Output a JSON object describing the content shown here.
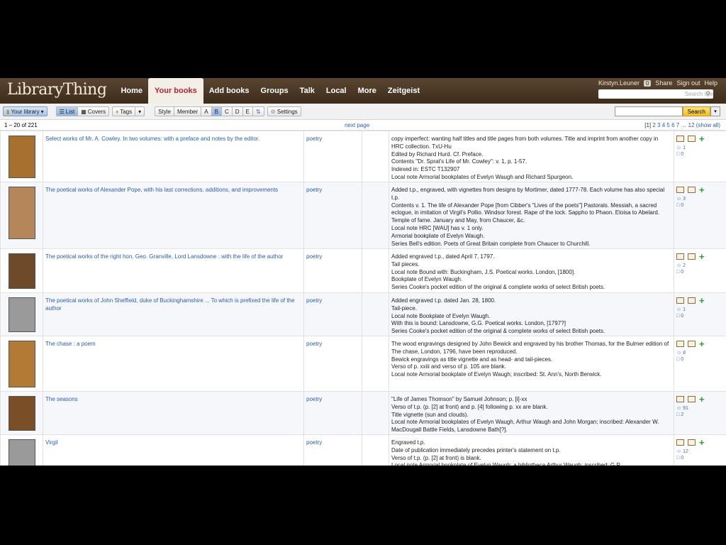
{
  "header": {
    "logo": "LibraryThing",
    "nav": [
      "Home",
      "Your books",
      "Add books",
      "Groups",
      "Talk",
      "Local",
      "More",
      "Zeitgeist"
    ],
    "active_nav": "Your books",
    "user": "Kirstyn.Leuner",
    "badge": "0",
    "links": [
      "Share",
      "Sign out",
      "Help"
    ],
    "search_placeholder": "Search site"
  },
  "toolbar": {
    "your_library": "Your library",
    "list": "List",
    "covers": "Covers",
    "tags": "Tags",
    "style": "Style",
    "member": "Member",
    "letters": [
      "A",
      "B",
      "C",
      "D",
      "E"
    ],
    "selected_letter": "B",
    "settings": "Settings",
    "search_button": "Search"
  },
  "pager": {
    "range": "1 – 20 of 221",
    "next": "next page",
    "current": "[1]",
    "pages": "2 3 4 5 6 7 … 12 (show all)"
  },
  "books": [
    {
      "title": "Select works of Mr. A. Cowley. In two volumes: with a preface and notes by the editor.",
      "tag": "poetry",
      "comments": "copy imperfect: wanting half titles and title pages from both volumes. Title and imprint from another copy in HRC collection. TxU-Hu\nEdited by Richard Hurd. Cf. Preface.\nContents \"Dr. Sprat's Life of Mr. Cowley\": v. 1, p. 1-57.\nIndexed in: ESTC T132907\nLocal note Armorial bookplates of Evelyn Waugh and Richard Spurgeon.",
      "members": "1",
      "reviews": "0",
      "cover_color": "#a8702e"
    },
    {
      "title": "The poetical works of Alexander Pope, with his last corrections, additions, and improvements",
      "tag": "poetry",
      "comments": "Added t.p., engraved, with vignettes from designs by Mortimer, dated 1777-78. Each volume has also special t.p.\nContents v. 1. The life of Alexander Pope [from Cibber's \"Lives of the poets\"] Pastorals. Messiah, a sacred eclogue, in imitation of Virgil's Pollio. Windsor forest. Rape of the lock. Sappho to Phaon. Eloisa to Abelard. Temple of fame. January and May, from Chaucer, &c.\nLocal note HRC [WAU] has v. 1 only.\nArmorial bookplate of Evelyn Waugh.\nSeries Bell's edition. Poets of Great Britain complete from Chaucer to Churchill.",
      "members": "3",
      "reviews": "0",
      "cover_color": "#b5865a"
    },
    {
      "title": "The poetical works of the right hon. Geo. Granville, Lord Lansdowne : with the life of the author",
      "tag": "poetry",
      "comments": "Added engraved t.p., dated April 7, 1797.\nTail pieces.\nLocal note Bound with: Buckingham, J.S. Poetical works. London, [1800].\nBookplate of Evelyn Waugh.\nSeries Cooke's pocket edition of the original & complete works of select British poets.",
      "members": "2",
      "reviews": "0",
      "cover_color": "#6e4a2a"
    },
    {
      "title": "The poetical works of John Sheffield, duke of Buckinghamshire ... To which is prefixed the life of the author",
      "tag": "poetry",
      "comments": "Added engraved t.p. dated Jan. 28, 1800.\nTail-piece.\nLocal note Bookplate of Evelyn Waugh.\nWith this is bound: Lansdowne, G.G. Poetical works. London, [1797?]\nSeries Cooke's pocket edition of the original & complete works of select British poets.",
      "members": "1",
      "reviews": "0",
      "cover_color": "#9a9a9a"
    },
    {
      "title": "The chase : a poem",
      "tag": "poetry",
      "comments": "The wood engravings designed by John Bewick and engraved by his brother Thomas, for the Bulmer edition of The chase, London, 1796, have been reproduced.\nBewick engravings as title vignette and as head- and tail-pieces.\nVerso of p. xxiii and verso of p. 105 are blank.\nLocal note Armorial bookplate of Evelyn Waugh; inscribed: St. Ann's, North Berwick.",
      "members": "8",
      "reviews": "0",
      "cover_color": "#b37a35"
    },
    {
      "title": "The seasons",
      "tag": "poetry",
      "comments": "\"Life of James Thomson\" by Samuel Johnson; p. [i]-xx\nVerso of t.p. (p. [2] at front) and p. [4] following p. xx are blank.\nTitle vignette (sun and clouds).\nLocal note Armorial bookplates of Evelyn Waugh, Arthur Waugh and John Morgan; inscribed: Alexander W. MacDougall Battle Fields, Lansdowne Bath[?].",
      "members": "91",
      "reviews": "2",
      "cover_color": "#7a4e26"
    },
    {
      "title": "Virgil",
      "tag": "poetry",
      "comments": "Engraved t.p.\nDate of publication immediately precedes printer's statement on t.p.\nVerso of t.p. (p. [2] at front) is blank.\nLocal note Armorial bookplate of Evelyn Waugh; a bibliotheca Arthur Waugh; inscribed: G.R.",
      "members": "12",
      "reviews": "0",
      "cover_color": "#9a9a9a"
    }
  ]
}
